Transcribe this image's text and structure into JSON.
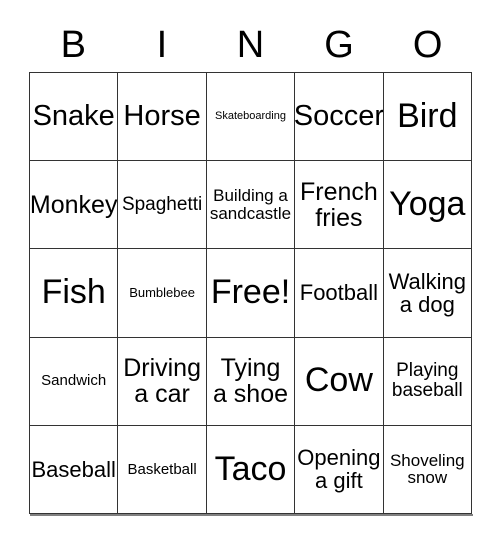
{
  "card": {
    "title_letters": [
      "B",
      "I",
      "N",
      "G",
      "O"
    ],
    "free_space_label": "Free!",
    "border_color": "#333333",
    "background_color": "#ffffff",
    "text_color": "#000000"
  },
  "grid": {
    "columns": 5,
    "rows": 5,
    "cells": [
      {
        "text": "Snake",
        "size": "fs-xl"
      },
      {
        "text": "Horse",
        "size": "fs-xl"
      },
      {
        "text": "Skateboarding",
        "size": "fs-micro"
      },
      {
        "text": "Soccer",
        "size": "fs-xl"
      },
      {
        "text": "Bird",
        "size": "fs-xxl"
      },
      {
        "text": "Monkey",
        "size": "fs-lg"
      },
      {
        "text": "Spaghetti",
        "size": "fs-sm"
      },
      {
        "text": "Building a\nsandcastle",
        "size": "fs-xs"
      },
      {
        "text": "French\nfries",
        "size": "fs-lg"
      },
      {
        "text": "Yoga",
        "size": "fs-xxl"
      },
      {
        "text": "Fish",
        "size": "fs-xxl"
      },
      {
        "text": "Bumblebee",
        "size": "fs-tiny"
      },
      {
        "text": "Free!",
        "size": "fs-xxl"
      },
      {
        "text": "Football",
        "size": "fs-md"
      },
      {
        "text": "Walking\na dog",
        "size": "fs-md"
      },
      {
        "text": "Sandwich",
        "size": "fs-xxs"
      },
      {
        "text": "Driving\na car",
        "size": "fs-lg"
      },
      {
        "text": "Tying\na shoe",
        "size": "fs-lg"
      },
      {
        "text": "Cow",
        "size": "fs-xxl"
      },
      {
        "text": "Playing\nbaseball",
        "size": "fs-sm"
      },
      {
        "text": "Baseball",
        "size": "fs-md"
      },
      {
        "text": "Basketball",
        "size": "fs-xxs"
      },
      {
        "text": "Taco",
        "size": "fs-xxl"
      },
      {
        "text": "Opening\na gift",
        "size": "fs-md"
      },
      {
        "text": "Shoveling\nsnow",
        "size": "fs-xs"
      }
    ]
  }
}
